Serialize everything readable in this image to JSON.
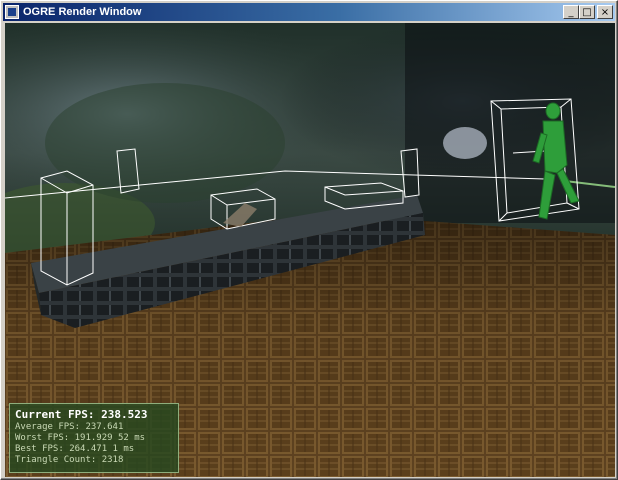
{
  "window": {
    "title": "OGRE Render Window",
    "buttons": {
      "minimize": "_",
      "maximize": "□",
      "close": "×"
    }
  },
  "stats": {
    "current_fps_label": "Current FPS:",
    "current_fps": "238.523",
    "average_fps_label": "Average FPS:",
    "average_fps": "237.641",
    "worst_fps_label": "Worst FPS:",
    "worst_fps": "191.929 52 ms",
    "best_fps_label": "Best FPS:",
    "best_fps": "264.471 1 ms",
    "triangle_count_label": "Triangle Count:",
    "triangle_count": "2318"
  },
  "colors": {
    "titlebar_start": "#0a246a",
    "titlebar_end": "#a6caf0",
    "floor": "#6b4a22",
    "wireframe": "#ffffff",
    "robot": "#2e9e3a",
    "overlay": "#264820"
  }
}
